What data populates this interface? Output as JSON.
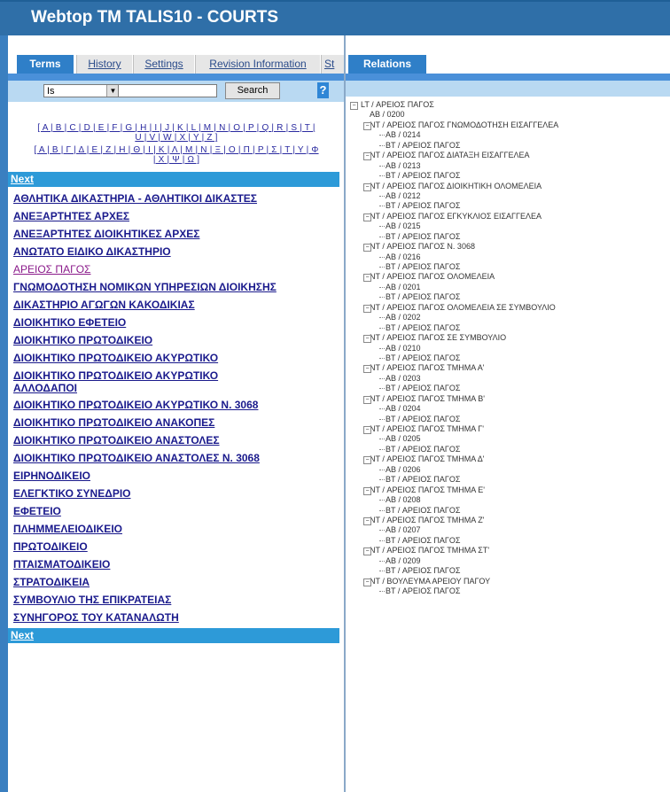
{
  "window": {
    "title": "Webtop TM TALIS10 - COURTS"
  },
  "left": {
    "tabs": [
      "Terms",
      "History",
      "Settings",
      "Revision Information",
      "St"
    ],
    "search": {
      "operator": "Is",
      "value": "",
      "button": "Search",
      "help": "?"
    },
    "alphabet": {
      "latin_line1": "[ A | B | C | D | E | F | G | H | I | J | K | L | M | N | O | P | Q | R | S | T |",
      "latin_line2": "U | V | W | X | Y | Z ]",
      "greek_line1": "[ Α | Β | Γ | Δ | Ε | Ζ | Η | Θ | Ι | Κ | Λ | Μ | Ν | Ξ | Ο | Π | Ρ | Σ | Τ | Υ | Φ",
      "greek_line2": "| Χ | Ψ | Ω ]"
    },
    "next_top": "Next",
    "next_bottom": "Next",
    "terms": [
      "ΑΘΛΗΤΙΚΑ ΔΙΚΑΣΤΗΡΙΑ - ΑΘΛΗΤΙΚΟΙ ΔΙΚΑΣΤΕΣ",
      "ΑΝΕΞΑΡΤΗΤΕΣ ΑΡΧΕΣ",
      "ΑΝΕΞΑΡΤΗΤΕΣ ΔΙΟΙΚΗΤΙΚΕΣ ΑΡΧΕΣ",
      "ΑΝΩΤΑΤΟ ΕΙΔΙΚΟ ΔΙΚΑΣΤΗΡΙΟ",
      "ΑΡΕΙΟΣ ΠΑΓΟΣ",
      "ΓΝΩΜΟΔΟΤΗΣΗ ΝΟΜΙΚΩΝ ΥΠΗΡΕΣΙΩΝ ΔΙΟΙΚΗΣΗΣ",
      "ΔΙΚΑΣΤΗΡΙΟ ΑΓΩΓΩΝ ΚΑΚΟΔΙΚΙΑΣ",
      "ΔΙΟΙΚΗΤΙΚΟ ΕΦΕΤΕΙΟ",
      "ΔΙΟΙΚΗΤΙΚΟ ΠΡΩΤΟΔΙΚΕΙΟ",
      "ΔΙΟΙΚΗΤΙΚΟ ΠΡΩΤΟΔΙΚΕΙΟ ΑΚΥΡΩΤΙΚΟ",
      "ΔΙΟΙΚΗΤΙΚΟ ΠΡΩΤΟΔΙΚΕΙΟ ΑΚΥΡΩΤΙΚΟ ΑΛΛΟΔΑΠΟΙ",
      "ΔΙΟΙΚΗΤΙΚΟ ΠΡΩΤΟΔΙΚΕΙΟ ΑΚΥΡΩΤΙΚΟ Ν. 3068",
      "ΔΙΟΙΚΗΤΙΚΟ ΠΡΩΤΟΔΙΚΕΙΟ ΑΝΑΚΟΠΕΣ",
      "ΔΙΟΙΚΗΤΙΚΟ ΠΡΩΤΟΔΙΚΕΙΟ ΑΝΑΣΤΟΛΕΣ",
      "ΔΙΟΙΚΗΤΙΚΟ ΠΡΩΤΟΔΙΚΕΙΟ ΑΝΑΣΤΟΛΕΣ Ν. 3068",
      "ΕΙΡΗΝΟΔΙΚΕΙΟ",
      "ΕΛΕΓΚΤΙΚΟ ΣΥΝΕΔΡΙΟ",
      "ΕΦΕΤΕΙΟ",
      "ΠΛΗΜΜΕΛΕΙΟΔΙΚΕΙΟ",
      "ΠΡΩΤΟΔΙΚΕΙΟ",
      "ΠΤΑΙΣΜΑΤΟΔΙΚΕΙΟ",
      "ΣΤΡΑΤΟΔΙΚΕΙΑ",
      "ΣΥΜΒΟΥΛΙΟ ΤΗΣ ΕΠΙΚΡΑΤΕΙΑΣ",
      "ΣΥΝΗΓΟΡΟΣ ΤΟΥ ΚΑΤΑΝΑΛΩΤΗ"
    ]
  },
  "right": {
    "tab": "Relations",
    "tree": [
      {
        "level": 0,
        "text": "LT / ΑΡΕΙΟΣ ΠΑΓΟΣ",
        "toggle": "−"
      },
      {
        "level": 1,
        "text": "AB / 0200"
      },
      {
        "level": 1,
        "text": "NT / ΑΡΕΙΟΣ ΠΑΓΟΣ ΓΝΩΜΟΔΟΤΗΣΗ ΕΙΣΑΓΓΕΛΕΑ",
        "toggle": "−"
      },
      {
        "level": 2,
        "text": "AB / 0214"
      },
      {
        "level": 2,
        "text": "BT / ΑΡΕΙΟΣ ΠΑΓΟΣ"
      },
      {
        "level": 1,
        "text": "NT / ΑΡΕΙΟΣ ΠΑΓΟΣ ΔΙΑΤΑΞΗ ΕΙΣΑΓΓΕΛΕΑ",
        "toggle": "−"
      },
      {
        "level": 2,
        "text": "AB / 0213"
      },
      {
        "level": 2,
        "text": "BT / ΑΡΕΙΟΣ ΠΑΓΟΣ"
      },
      {
        "level": 1,
        "text": "NT / ΑΡΕΙΟΣ ΠΑΓΟΣ ΔΙΟΙΚΗΤΙΚΗ ΟΛΟΜΕΛΕΙΑ",
        "toggle": "−"
      },
      {
        "level": 2,
        "text": "AB / 0212"
      },
      {
        "level": 2,
        "text": "BT / ΑΡΕΙΟΣ ΠΑΓΟΣ"
      },
      {
        "level": 1,
        "text": "NT / ΑΡΕΙΟΣ ΠΑΓΟΣ ΕΓΚΥΚΛΙΟΣ ΕΙΣΑΓΓΕΛΕΑ",
        "toggle": "−"
      },
      {
        "level": 2,
        "text": "AB / 0215"
      },
      {
        "level": 2,
        "text": "BT / ΑΡΕΙΟΣ ΠΑΓΟΣ"
      },
      {
        "level": 1,
        "text": "NT / ΑΡΕΙΟΣ ΠΑΓΟΣ Ν. 3068",
        "toggle": "−"
      },
      {
        "level": 2,
        "text": "AB / 0216"
      },
      {
        "level": 2,
        "text": "BT / ΑΡΕΙΟΣ ΠΑΓΟΣ"
      },
      {
        "level": 1,
        "text": "NT / ΑΡΕΙΟΣ ΠΑΓΟΣ ΟΛΟΜΕΛΕΙΑ",
        "toggle": "−"
      },
      {
        "level": 2,
        "text": "AB / 0201"
      },
      {
        "level": 2,
        "text": "BT / ΑΡΕΙΟΣ ΠΑΓΟΣ"
      },
      {
        "level": 1,
        "text": "NT / ΑΡΕΙΟΣ ΠΑΓΟΣ ΟΛΟΜΕΛΕΙΑ ΣΕ ΣΥΜΒΟΥΛΙΟ",
        "toggle": "−"
      },
      {
        "level": 2,
        "text": "AB / 0202"
      },
      {
        "level": 2,
        "text": "BT / ΑΡΕΙΟΣ ΠΑΓΟΣ"
      },
      {
        "level": 1,
        "text": "NT / ΑΡΕΙΟΣ ΠΑΓΟΣ ΣΕ ΣΥΜΒΟΥΛΙΟ",
        "toggle": "−"
      },
      {
        "level": 2,
        "text": "AB / 0210"
      },
      {
        "level": 2,
        "text": "BT / ΑΡΕΙΟΣ ΠΑΓΟΣ"
      },
      {
        "level": 1,
        "text": "NT / ΑΡΕΙΟΣ ΠΑΓΟΣ ΤΜΗΜΑ Α'",
        "toggle": "−"
      },
      {
        "level": 2,
        "text": "AB / 0203"
      },
      {
        "level": 2,
        "text": "BT / ΑΡΕΙΟΣ ΠΑΓΟΣ"
      },
      {
        "level": 1,
        "text": "NT / ΑΡΕΙΟΣ ΠΑΓΟΣ ΤΜΗΜΑ Β'",
        "toggle": "−"
      },
      {
        "level": 2,
        "text": "AB / 0204"
      },
      {
        "level": 2,
        "text": "BT / ΑΡΕΙΟΣ ΠΑΓΟΣ"
      },
      {
        "level": 1,
        "text": "NT / ΑΡΕΙΟΣ ΠΑΓΟΣ ΤΜΗΜΑ Γ'",
        "toggle": "−"
      },
      {
        "level": 2,
        "text": "AB / 0205"
      },
      {
        "level": 2,
        "text": "BT / ΑΡΕΙΟΣ ΠΑΓΟΣ"
      },
      {
        "level": 1,
        "text": "NT / ΑΡΕΙΟΣ ΠΑΓΟΣ ΤΜΗΜΑ Δ'",
        "toggle": "−"
      },
      {
        "level": 2,
        "text": "AB / 0206"
      },
      {
        "level": 2,
        "text": "BT / ΑΡΕΙΟΣ ΠΑΓΟΣ"
      },
      {
        "level": 1,
        "text": "NT / ΑΡΕΙΟΣ ΠΑΓΟΣ ΤΜΗΜΑ Ε'",
        "toggle": "−"
      },
      {
        "level": 2,
        "text": "AB / 0208"
      },
      {
        "level": 2,
        "text": "BT / ΑΡΕΙΟΣ ΠΑΓΟΣ"
      },
      {
        "level": 1,
        "text": "NT / ΑΡΕΙΟΣ ΠΑΓΟΣ ΤΜΗΜΑ Ζ'",
        "toggle": "−"
      },
      {
        "level": 2,
        "text": "AB / 0207"
      },
      {
        "level": 2,
        "text": "BT / ΑΡΕΙΟΣ ΠΑΓΟΣ"
      },
      {
        "level": 1,
        "text": "NT / ΑΡΕΙΟΣ ΠΑΓΟΣ ΤΜΗΜΑ ΣΤ'",
        "toggle": "−"
      },
      {
        "level": 2,
        "text": "AB / 0209"
      },
      {
        "level": 2,
        "text": "BT / ΑΡΕΙΟΣ ΠΑΓΟΣ"
      },
      {
        "level": 1,
        "text": "NT / ΒΟΥΛΕΥΜΑ ΑΡΕΙΟΥ ΠΑΓΟΥ",
        "toggle": "−"
      },
      {
        "level": 2,
        "text": "BT / ΑΡΕΙΟΣ ΠΑΓΟΣ"
      }
    ]
  },
  "colors": {
    "titlebar": "#2f6fa8",
    "tab_active": "#2f7fc8",
    "next_bar": "#2d9ad8",
    "search_band": "#b9d9f2",
    "link": "#1a1a8c",
    "visited": "#8a1a8a"
  }
}
